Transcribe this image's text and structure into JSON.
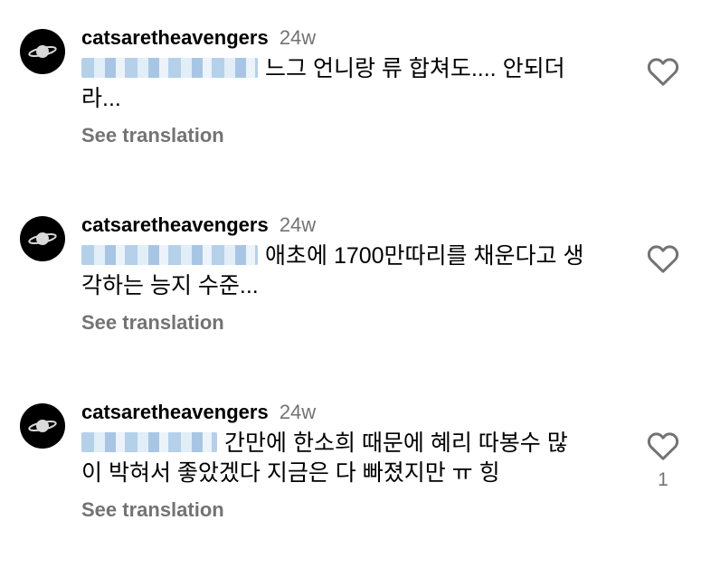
{
  "comments": [
    {
      "username": "catsaretheavengers",
      "time": "24w",
      "mention_icon": "blurred-mention",
      "line1": "느그 언니랑 류 합쳐도.... 안되더",
      "line2": "라...",
      "see_translation": "See translation",
      "likes": ""
    },
    {
      "username": "catsaretheavengers",
      "time": "24w",
      "mention_icon": "blurred-mention",
      "line1": "애초에 1700만따리를 채운다고 생",
      "line2": "각하는 능지 수준...",
      "see_translation": "See translation",
      "likes": ""
    },
    {
      "username": "catsaretheavengers",
      "time": "24w",
      "mention_icon": "blurred-mention",
      "line1": "간만에 한소희 때문에 혜리 따봉수 많",
      "line2": "이 박혀서 좋았겠다 지금은 다 빠졌지만 ㅠ 힝",
      "see_translation": "See translation",
      "likes": "1"
    }
  ],
  "colors": {
    "text": "#000000",
    "secondary": "#737373",
    "avatar_bg": "#000000"
  },
  "icons": {
    "avatar": "saturn-planet-icon",
    "like": "heart-outline-icon"
  }
}
